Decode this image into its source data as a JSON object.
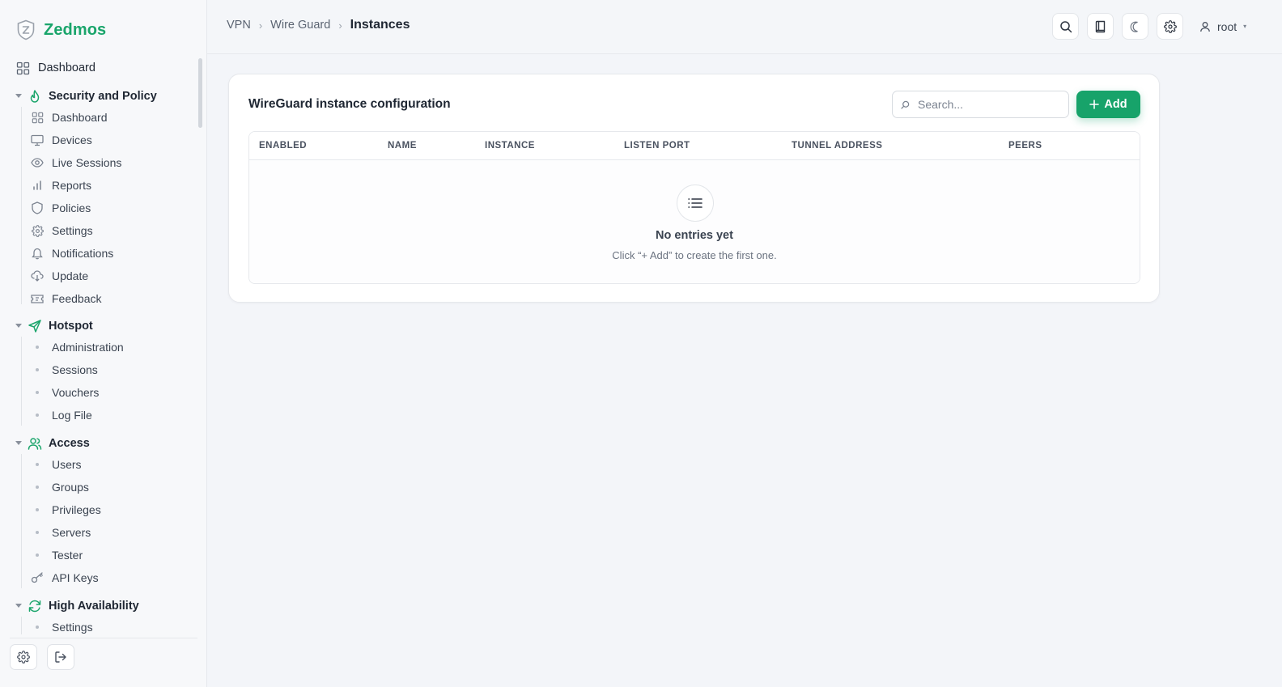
{
  "app": {
    "name": "Zedmos"
  },
  "colors": {
    "accent": "#17a36a",
    "brand": "#1aa56b"
  },
  "sidebar": {
    "top_item": {
      "label": "Dashboard",
      "icon": "grid-icon"
    },
    "groups": [
      {
        "label": "Security and Policy",
        "icon": "flame-icon",
        "items": [
          {
            "label": "Dashboard",
            "icon": "grid-icon"
          },
          {
            "label": "Devices",
            "icon": "monitor-icon"
          },
          {
            "label": "Live Sessions",
            "icon": "eye-icon"
          },
          {
            "label": "Reports",
            "icon": "bar-chart-icon"
          },
          {
            "label": "Policies",
            "icon": "shield-icon"
          },
          {
            "label": "Settings",
            "icon": "gear-icon"
          },
          {
            "label": "Notifications",
            "icon": "bell-icon"
          },
          {
            "label": "Update",
            "icon": "cloud-download-icon"
          },
          {
            "label": "Feedback",
            "icon": "ticket-icon"
          }
        ]
      },
      {
        "label": "Hotspot",
        "icon": "send-icon",
        "items": [
          {
            "label": "Administration"
          },
          {
            "label": "Sessions"
          },
          {
            "label": "Vouchers"
          },
          {
            "label": "Log File"
          }
        ]
      },
      {
        "label": "Access",
        "icon": "users-icon",
        "items": [
          {
            "label": "Users"
          },
          {
            "label": "Groups"
          },
          {
            "label": "Privileges"
          },
          {
            "label": "Servers"
          },
          {
            "label": "Tester"
          },
          {
            "label": "API Keys",
            "icon": "key-icon"
          }
        ]
      },
      {
        "label": "High Availability",
        "icon": "refresh-icon",
        "items": [
          {
            "label": "Settings"
          }
        ]
      }
    ]
  },
  "header": {
    "breadcrumb": [
      "VPN",
      "Wire Guard",
      "Instances"
    ],
    "user": "root"
  },
  "main": {
    "title": "WireGuard instance configuration",
    "search": {
      "placeholder": "Search...",
      "value": ""
    },
    "add_label": "Add",
    "columns": [
      "ENABLED",
      "NAME",
      "INSTANCE",
      "LISTEN PORT",
      "TUNNEL ADDRESS",
      "PEERS"
    ],
    "rows": [],
    "empty": {
      "title": "No entries yet",
      "subtitle": "Click “+ Add” to create the first one."
    }
  }
}
